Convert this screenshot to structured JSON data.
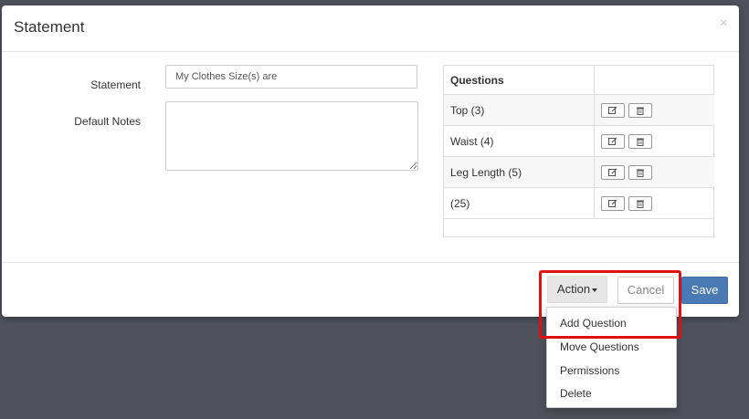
{
  "modal": {
    "title": "Statement",
    "close": "×"
  },
  "form": {
    "statement_label": "Statement",
    "statement_value": "My Clothes Size(s) are",
    "notes_label": "Default Notes",
    "notes_value": ""
  },
  "questions_table": {
    "header": "Questions",
    "rows": [
      {
        "name": "Top (3)"
      },
      {
        "name": "Waist (4)"
      },
      {
        "name": "Leg Length (5)"
      },
      {
        "name": "(25)"
      }
    ]
  },
  "footer": {
    "action_label": "Action",
    "cancel_label": "Cancel",
    "save_label": "Save"
  },
  "action_menu": {
    "items": [
      "Add Question",
      "Move Questions",
      "Permissions",
      "Delete"
    ]
  },
  "colors": {
    "backdrop": "#4f525c",
    "primary": "#4a7ab5",
    "highlight": "#e01010"
  },
  "icons": {
    "edit": "edit-icon",
    "delete": "trash-icon",
    "close": "close-icon",
    "caret": "caret-down-icon"
  }
}
